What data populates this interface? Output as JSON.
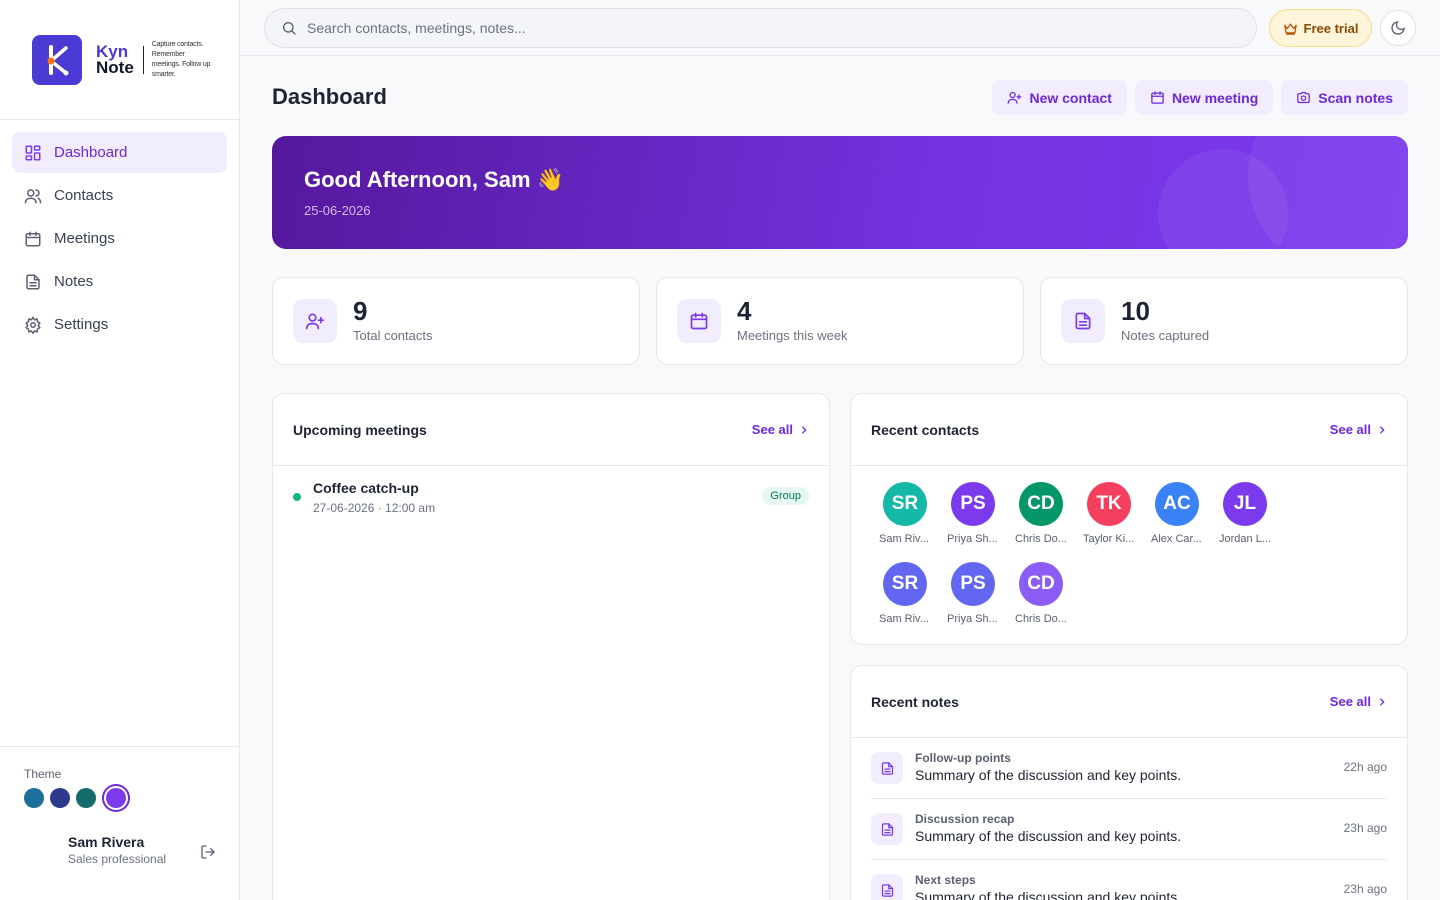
{
  "brand": {
    "name_part1": "Kyn",
    "name_part2": "Note",
    "tagline": "Capture contacts. Remember meetings. Follow up smarter.",
    "color": "#4b3ad3"
  },
  "nav": {
    "items": [
      {
        "label": "Dashboard",
        "icon": "grid-icon",
        "active": true
      },
      {
        "label": "Contacts",
        "icon": "users-icon",
        "active": false
      },
      {
        "label": "Meetings",
        "icon": "calendar-icon",
        "active": false
      },
      {
        "label": "Notes",
        "icon": "file-text-icon",
        "active": false
      },
      {
        "label": "Settings",
        "icon": "gear-icon",
        "active": false
      }
    ]
  },
  "theme": {
    "label": "Theme",
    "swatches": [
      "#1d6e99",
      "#2e3a8c",
      "#146b6b",
      "#7c3aed"
    ],
    "selected_index": 3
  },
  "user": {
    "name": "Sam Rivera",
    "role": "Sales professional"
  },
  "topbar": {
    "search_placeholder": "Search contacts, meetings, notes...",
    "trial_label": "Free trial"
  },
  "page": {
    "title": "Dashboard",
    "actions": [
      "New contact",
      "New meeting",
      "Scan notes"
    ]
  },
  "hero": {
    "greeting": "Good Afternoon, Sam 👋",
    "date": "25-06-2026"
  },
  "stats": [
    {
      "value": "9",
      "label": "Total contacts",
      "icon": "user-plus-icon"
    },
    {
      "value": "4",
      "label": "Meetings this week",
      "icon": "calendar-icon"
    },
    {
      "value": "10",
      "label": "Notes captured",
      "icon": "file-text-icon"
    }
  ],
  "upcoming": {
    "title": "Upcoming meetings",
    "see_all": "See all",
    "items": [
      {
        "title": "Coffee catch-up",
        "time": "27-06-2026 · 12:00 am",
        "badge": "Group"
      }
    ]
  },
  "recent_contacts": {
    "title": "Recent contacts",
    "see_all": "See all",
    "items": [
      {
        "initials": "SR",
        "name": "Sam Riv...",
        "color": "#14b8a6"
      },
      {
        "initials": "PS",
        "name": "Priya Sh...",
        "color": "#7c3aed"
      },
      {
        "initials": "CD",
        "name": "Chris Do...",
        "color": "#059669"
      },
      {
        "initials": "TK",
        "name": "Taylor Ki...",
        "color": "#f43f5e"
      },
      {
        "initials": "AC",
        "name": "Alex Car...",
        "color": "#3b82f6"
      },
      {
        "initials": "JL",
        "name": "Jordan L...",
        "color": "#7c3aed"
      },
      {
        "initials": "SR",
        "name": "Sam Riv...",
        "color": "#6366f1"
      },
      {
        "initials": "PS",
        "name": "Priya Sh...",
        "color": "#6366f1"
      },
      {
        "initials": "CD",
        "name": "Chris Do...",
        "color": "#8b5cf6"
      }
    ]
  },
  "recent_notes": {
    "title": "Recent notes",
    "see_all": "See all",
    "items": [
      {
        "title": "Follow-up points",
        "body": "Summary of the discussion and key points.",
        "time": "22h ago"
      },
      {
        "title": "Discussion recap",
        "body": "Summary of the discussion and key points.",
        "time": "23h ago"
      },
      {
        "title": "Next steps",
        "body": "Summary of the discussion and key points.",
        "time": "23h ago"
      }
    ]
  }
}
